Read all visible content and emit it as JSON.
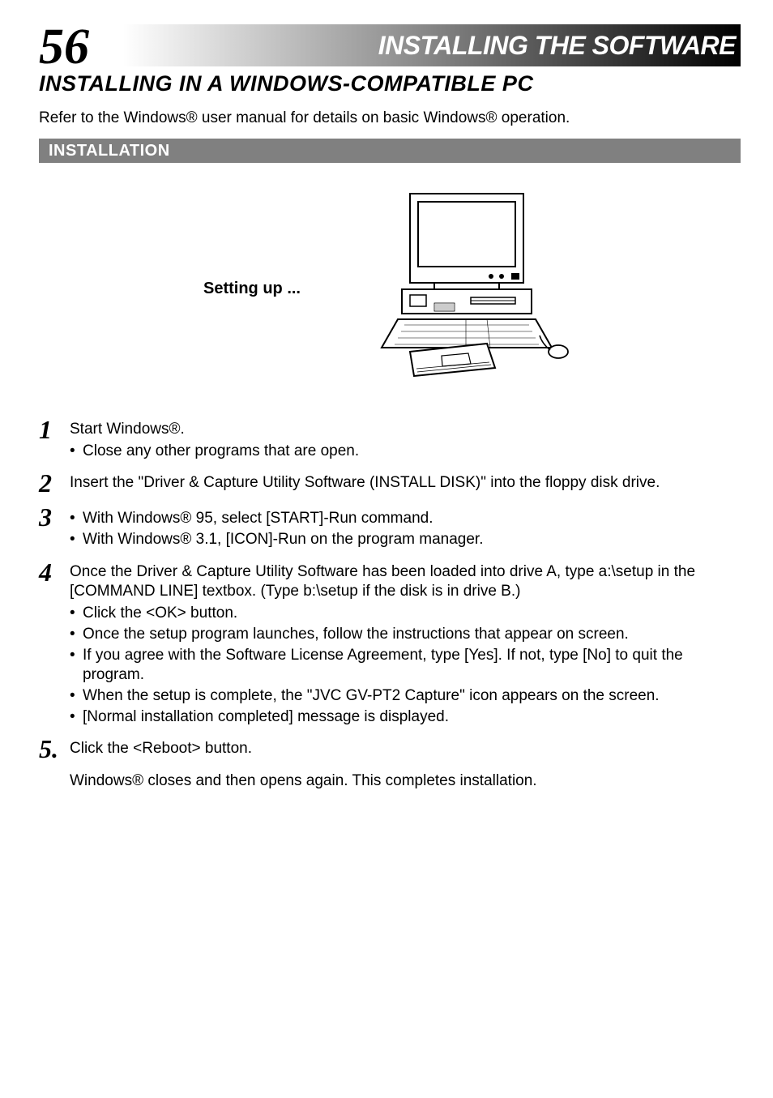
{
  "header": {
    "page_number": "56",
    "chapter": "INSTALLING THE SOFTWARE"
  },
  "section_title": "INSTALLING IN A WINDOWS-COMPATIBLE PC",
  "intro": "Refer to the Windows® user manual for details on basic Windows® operation.",
  "subhead": "INSTALLATION",
  "figure_caption": "Setting up ...",
  "steps": [
    {
      "num": "1",
      "lead": "Start Windows®.",
      "bullets": [
        "Close any other programs that are open."
      ]
    },
    {
      "num": "2",
      "lead": " Insert the \"Driver & Capture Utility Software (INSTALL DISK)\" into the floppy disk drive.",
      "bullets": []
    },
    {
      "num": "3",
      "lead": "",
      "bullets": [
        "With Windows® 95, select [START]-Run command.",
        "With Windows® 3.1, [ICON]-Run on the program manager."
      ]
    },
    {
      "num": "4",
      "lead": "Once the Driver & Capture Utility Software has been loaded into drive A, type a:\\setup in the [COMMAND LINE] textbox. (Type b:\\setup if the disk is in drive B.)",
      "bullets": [
        "Click the <OK> button.",
        "Once the setup program launches, follow the instructions that appear on screen.",
        "If you agree with the Software License Agreement, type [Yes]. If not, type [No] to quit the program.",
        "When the setup is complete, the \"JVC GV-PT2 Capture\" icon appears on the screen.",
        "[Normal installation completed] message is displayed."
      ]
    },
    {
      "num": "5.",
      "lead": "Click the <Reboot> button.",
      "bullets": []
    }
  ],
  "closing": "Windows® closes and then opens again. This completes installation."
}
